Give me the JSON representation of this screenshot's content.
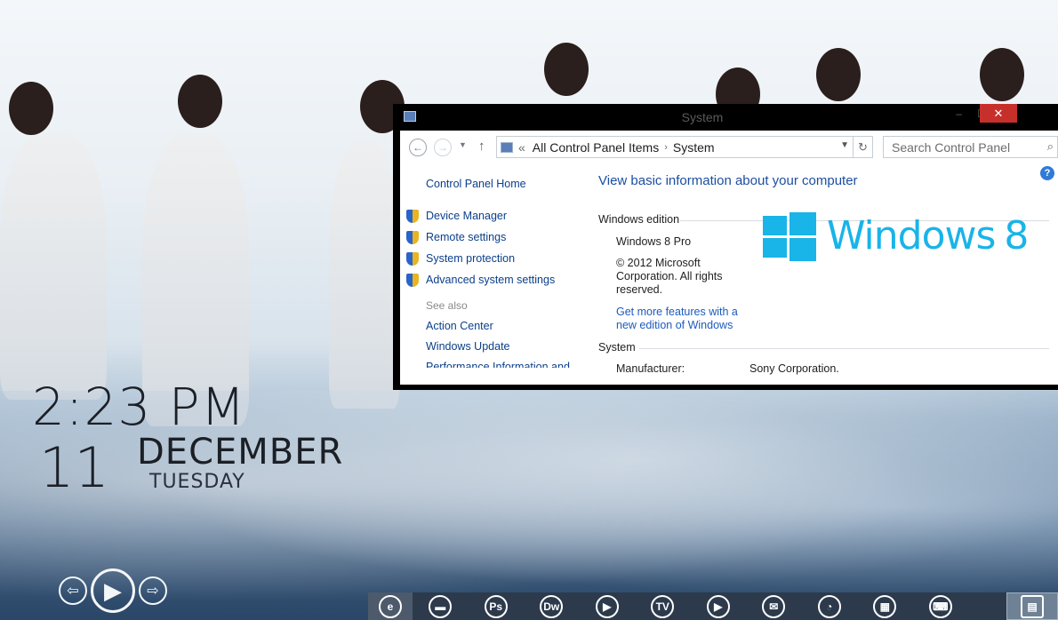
{
  "clock": {
    "time": "2:23 PM",
    "day": "11",
    "month": "DECEMBER",
    "weekday": "TUESDAY"
  },
  "media_controls": {
    "prev_icon": "arrow-left-icon",
    "play_icon": "play-icon",
    "next_icon": "arrow-right-icon"
  },
  "taskbar": {
    "items": [
      {
        "name": "internet-explorer",
        "glyph": "e"
      },
      {
        "name": "file-explorer",
        "glyph": "▬"
      },
      {
        "name": "photoshop",
        "glyph": "Ps"
      },
      {
        "name": "dreamweaver",
        "glyph": "Dw"
      },
      {
        "name": "media-player",
        "glyph": "▶"
      },
      {
        "name": "tv",
        "glyph": "TV"
      },
      {
        "name": "youtube",
        "glyph": "▶"
      },
      {
        "name": "messaging",
        "glyph": "💬"
      },
      {
        "name": "rss",
        "glyph": "◔"
      },
      {
        "name": "apps",
        "glyph": "▦"
      },
      {
        "name": "keyboard",
        "glyph": "⌨"
      },
      {
        "name": "control-panel",
        "glyph": "▤"
      }
    ]
  },
  "window": {
    "title": "System",
    "controls": {
      "minimize": "–",
      "maximize": "☐",
      "close": "✕"
    },
    "address": {
      "prefix": "«",
      "crumb1": "All Control Panel Items",
      "separator": "›",
      "crumb2": "System"
    },
    "search": {
      "placeholder": "Search Control Panel"
    },
    "help": "?",
    "left_pane": {
      "home": "Control Panel Home",
      "links": [
        "Device Manager",
        "Remote settings",
        "System protection",
        "Advanced system settings"
      ],
      "see_also_label": "See also",
      "see_also": [
        "Action Center",
        "Windows Update",
        "Performance Information and"
      ]
    },
    "main": {
      "heading": "View basic information about your computer",
      "edition_header": "Windows edition",
      "edition": "Windows 8 Pro",
      "copyright_1": "© 2012 Microsoft",
      "copyright_2": "Corporation. All rights",
      "copyright_3": "reserved.",
      "features_link_1": "Get more features with a",
      "features_link_2": "new edition of Windows",
      "logo_text": "Windows",
      "logo_version": "8",
      "system_header": "System",
      "manufacturer_label": "Manufacturer:",
      "manufacturer_value": "Sony Corporation."
    }
  },
  "colors": {
    "accent": "#19b4e8",
    "link": "#0b3f8a",
    "close": "#c7302a",
    "taskbar": "#2c3a4c"
  }
}
